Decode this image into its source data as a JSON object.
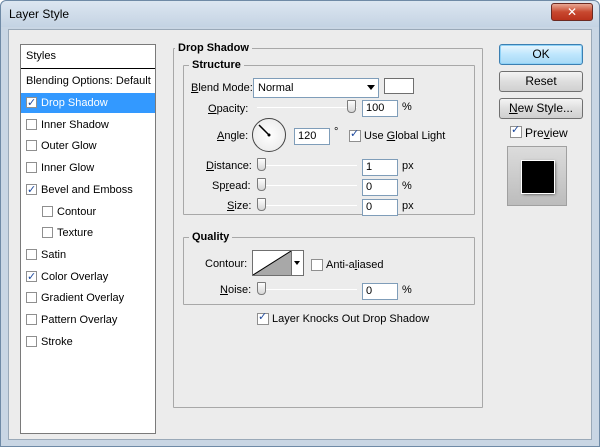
{
  "window": {
    "title": "Layer Style",
    "close_label": "✕"
  },
  "styles": {
    "header": "Styles",
    "blending_options": "Blending Options: Default",
    "items": [
      {
        "label": "Drop Shadow",
        "checked": true,
        "selected": true
      },
      {
        "label": "Inner Shadow",
        "checked": false
      },
      {
        "label": "Outer Glow",
        "checked": false
      },
      {
        "label": "Inner Glow",
        "checked": false
      },
      {
        "label": "Bevel and Emboss",
        "checked": true
      },
      {
        "label": "Contour",
        "checked": false,
        "indent": true
      },
      {
        "label": "Texture",
        "checked": false,
        "indent": true
      },
      {
        "label": "Satin",
        "checked": false
      },
      {
        "label": "Color Overlay",
        "checked": true
      },
      {
        "label": "Gradient Overlay",
        "checked": false
      },
      {
        "label": "Pattern Overlay",
        "checked": false
      },
      {
        "label": "Stroke",
        "checked": false
      }
    ]
  },
  "drop_shadow": {
    "title": "Drop Shadow",
    "structure": {
      "title": "Structure",
      "blend_mode_label": "Blend Mode:",
      "blend_mode_value": "Normal",
      "shadow_color": "#ffffff",
      "opacity_label": "Opacity:",
      "opacity_value": "100",
      "opacity_unit": "%",
      "angle_label": "Angle:",
      "angle_value": "120",
      "angle_unit": "°",
      "use_global_light_label": "Use Global Light",
      "use_global_light": true,
      "distance_label": "Distance:",
      "distance_value": "1",
      "distance_unit": "px",
      "spread_label": "Spread:",
      "spread_value": "0",
      "spread_unit": "%",
      "size_label": "Size:",
      "size_value": "0",
      "size_unit": "px"
    },
    "quality": {
      "title": "Quality",
      "contour_label": "Contour:",
      "anti_aliased_label": "Anti-aliased",
      "anti_aliased": false,
      "noise_label": "Noise:",
      "noise_value": "0",
      "noise_unit": "%"
    },
    "knocks_out_label": "Layer Knocks Out Drop Shadow",
    "knocks_out": true
  },
  "buttons": {
    "ok": "OK",
    "reset": "Reset",
    "new_style": "New Style..."
  },
  "preview": {
    "label": "Preview",
    "checked": true
  }
}
